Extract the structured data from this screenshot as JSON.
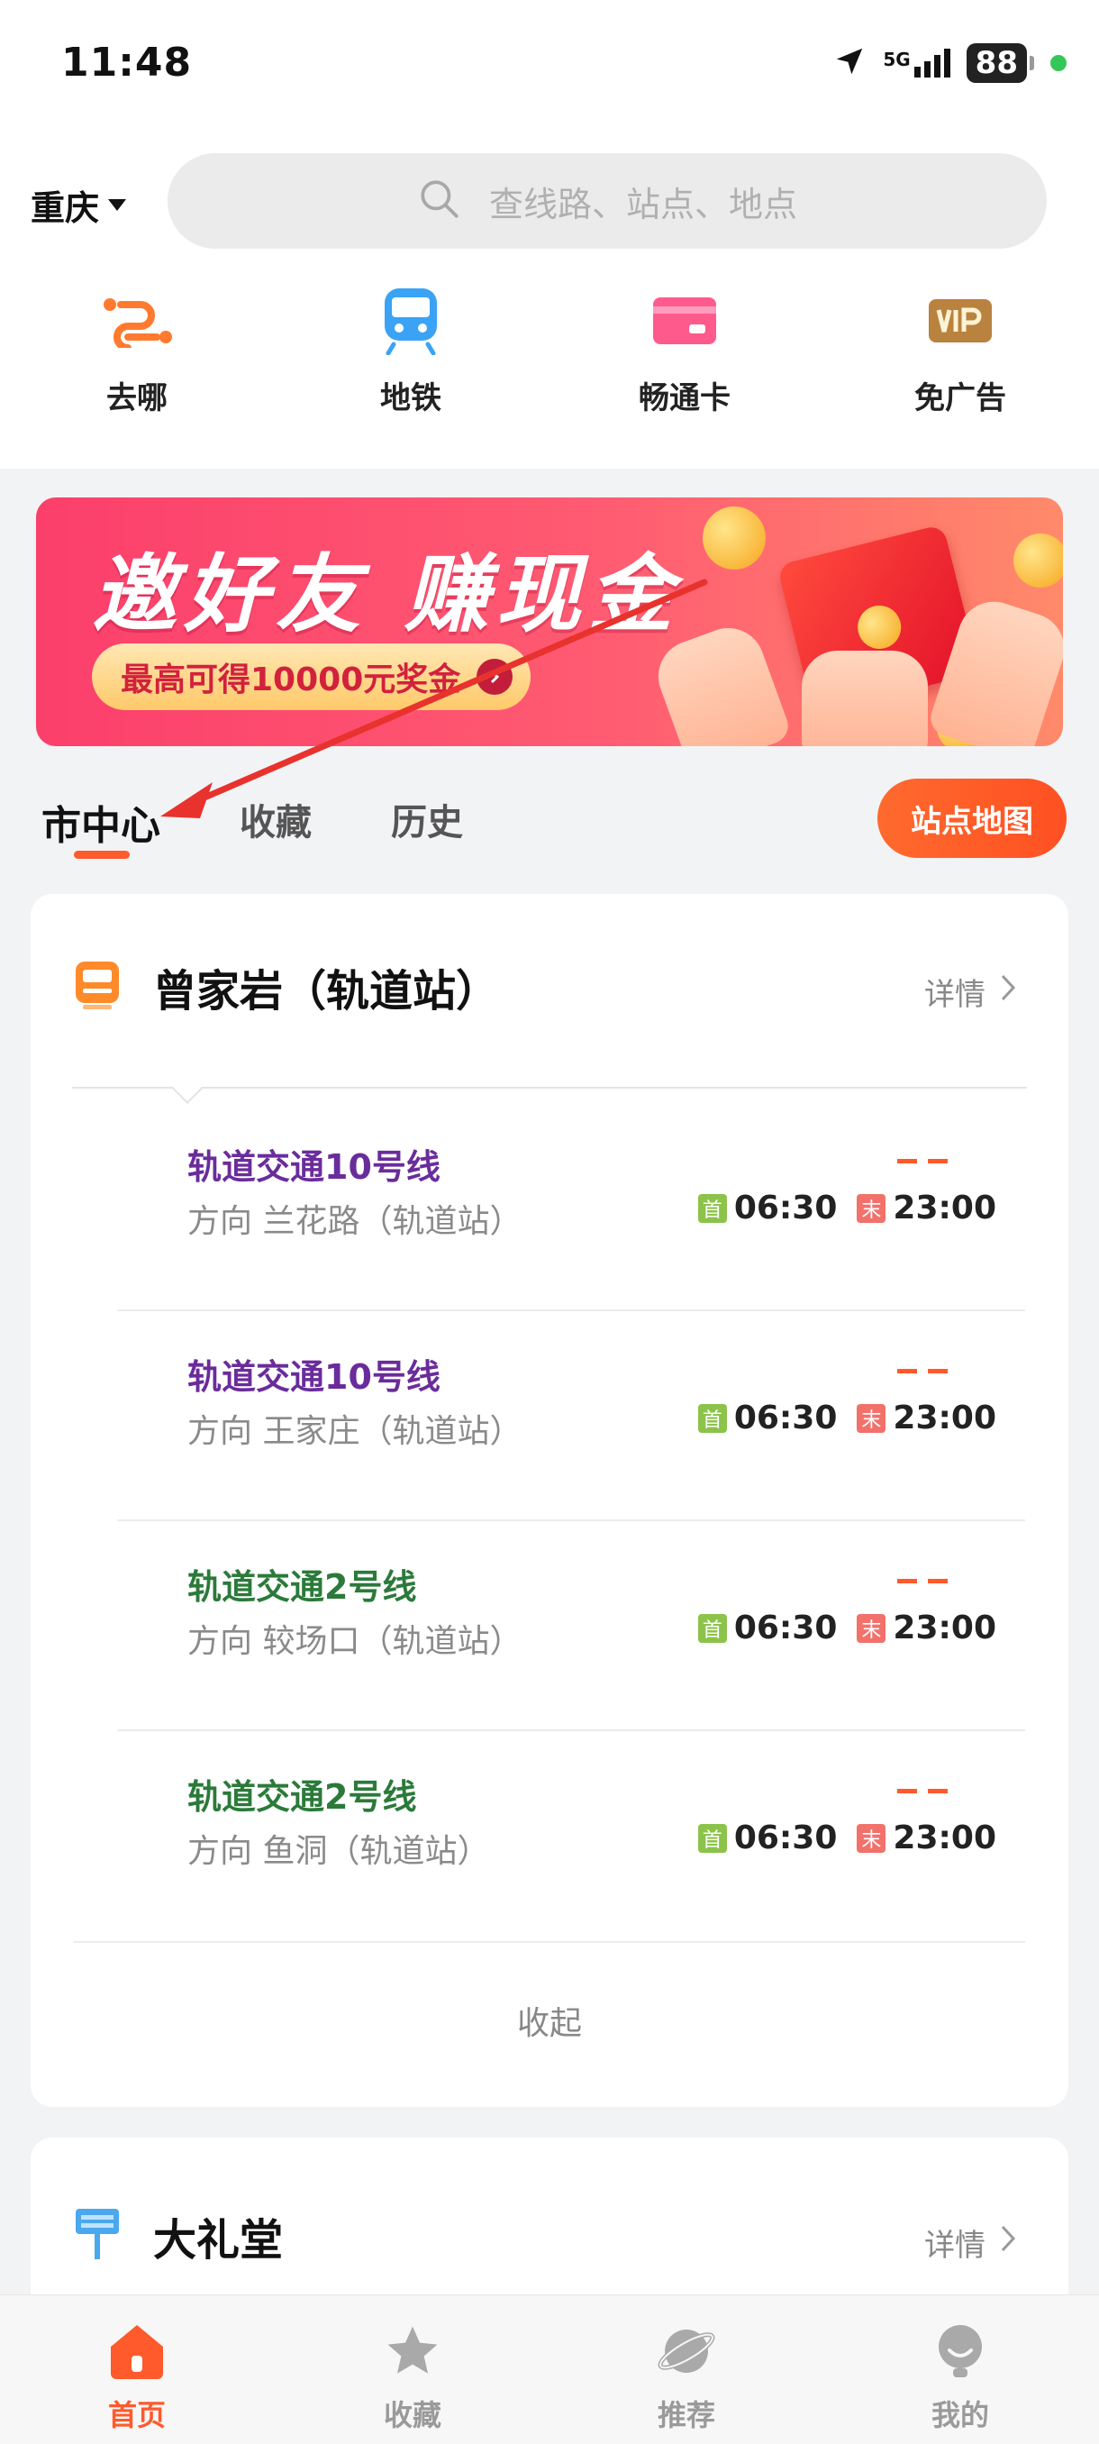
{
  "status_bar": {
    "time": "11:48",
    "network": "5G",
    "battery": "88"
  },
  "header": {
    "city": "重庆",
    "search_placeholder": "查线路、站点、地点"
  },
  "quick_nav": [
    {
      "label": "去哪",
      "icon": "route-icon"
    },
    {
      "label": "地铁",
      "icon": "metro-train-icon"
    },
    {
      "label": "畅通卡",
      "icon": "card-icon"
    },
    {
      "label": "免广告",
      "icon": "vip-icon"
    }
  ],
  "banner": {
    "title": "邀好友 赚现金",
    "subtitle": "最高可得10000元奖金"
  },
  "tabs": {
    "items": [
      "市中心",
      "收藏",
      "历史"
    ],
    "active": "市中心",
    "map_button": "站点地图"
  },
  "colors": {
    "accent": "#ff5a2c",
    "line10": "#6a2c9b",
    "line2": "#2b7a3a",
    "first_tag": "#8cc34a",
    "last_tag": "#f2716b"
  },
  "stations": [
    {
      "name": "曾家岩（轨道站）",
      "detail_label": "详情",
      "icon": "bus-stop-icon",
      "lines": [
        {
          "name": "轨道交通10号线",
          "direction": "方向 兰花路（轨道站）",
          "status": "– –",
          "first_tag": "首",
          "first_time": "06:30",
          "last_tag": "末",
          "last_time": "23:00"
        },
        {
          "name": "轨道交通10号线",
          "direction": "方向 王家庄（轨道站）",
          "status": "– –",
          "first_tag": "首",
          "first_time": "06:30",
          "last_tag": "末",
          "last_time": "23:00"
        },
        {
          "name": "轨道交通2号线",
          "direction": "方向 较场口（轨道站）",
          "status": "– –",
          "first_tag": "首",
          "first_time": "06:30",
          "last_tag": "末",
          "last_time": "23:00"
        },
        {
          "name": "轨道交通2号线",
          "direction": "方向 鱼洞（轨道站）",
          "status": "– –",
          "first_tag": "首",
          "first_time": "06:30",
          "last_tag": "末",
          "last_time": "23:00"
        }
      ],
      "collapse_label": "收起"
    },
    {
      "name": "大礼堂",
      "detail_label": "详情",
      "icon": "bus-sign-icon"
    }
  ],
  "bottom_nav": [
    {
      "label": "首页",
      "icon": "home-icon",
      "active": true
    },
    {
      "label": "收藏",
      "icon": "star-icon",
      "active": false
    },
    {
      "label": "推荐",
      "icon": "planet-icon",
      "active": false
    },
    {
      "label": "我的",
      "icon": "profile-icon",
      "active": false
    }
  ]
}
